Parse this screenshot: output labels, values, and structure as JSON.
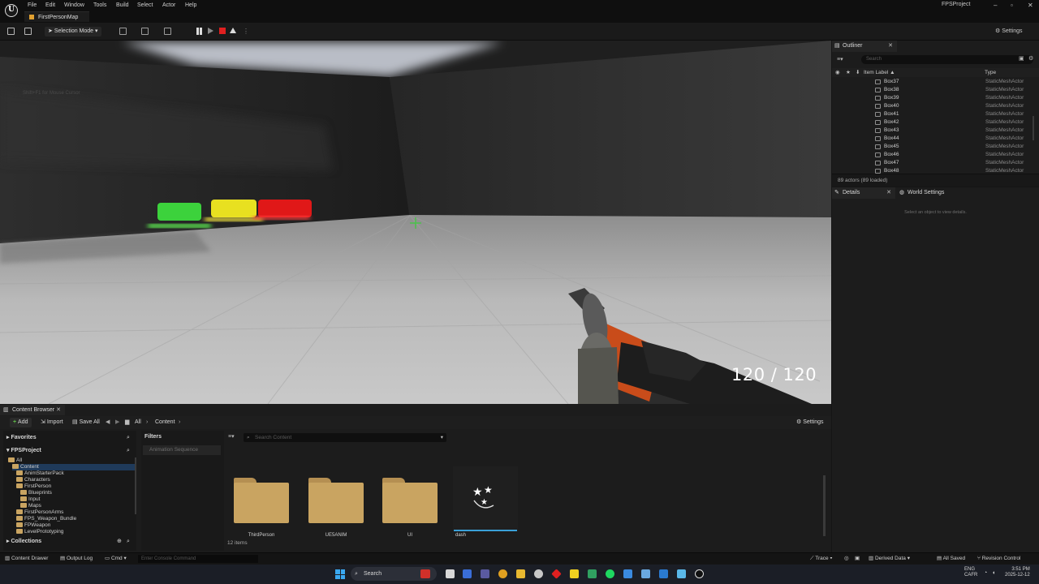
{
  "menubar": {
    "items": [
      "File",
      "Edit",
      "Window",
      "Tools",
      "Build",
      "Select",
      "Actor",
      "Help"
    ],
    "map_tab": "FirstPersonMap",
    "project": "FPSProject"
  },
  "toolbar": {
    "selection_mode": "Selection Mode",
    "settings": "Settings"
  },
  "viewport": {
    "hint": "Shift+F1 for Mouse Cursor",
    "ammo": "120 / 120",
    "health_fraction": 1.0,
    "colors": {
      "health": "#e0102a",
      "target_green": "#3cd23c",
      "target_yellow": "#e8e020",
      "target_red": "#e01818"
    }
  },
  "outliner": {
    "tab": "Outliner",
    "search_placeholder": "Search",
    "col_label": "Item Label ▲",
    "col_type": "Type",
    "rows": [
      {
        "label": "Box37",
        "type": "StaticMeshActor"
      },
      {
        "label": "Box38",
        "type": "StaticMeshActor"
      },
      {
        "label": "Box39",
        "type": "StaticMeshActor"
      },
      {
        "label": "Box40",
        "type": "StaticMeshActor"
      },
      {
        "label": "Box41",
        "type": "StaticMeshActor"
      },
      {
        "label": "Box42",
        "type": "StaticMeshActor"
      },
      {
        "label": "Box43",
        "type": "StaticMeshActor"
      },
      {
        "label": "Box44",
        "type": "StaticMeshActor"
      },
      {
        "label": "Box45",
        "type": "StaticMeshActor"
      },
      {
        "label": "Box46",
        "type": "StaticMeshActor"
      },
      {
        "label": "Box47",
        "type": "StaticMeshActor"
      },
      {
        "label": "Box48",
        "type": "StaticMeshActor"
      }
    ],
    "count": "89 actors (89 loaded)"
  },
  "details": {
    "tab": "Details",
    "world_tab": "World Settings",
    "empty_message": "Select an object to view details."
  },
  "content_browser": {
    "tab": "Content Browser",
    "add": "Add",
    "import": "Import",
    "save_all": "Save All",
    "crumb_all": "All",
    "crumb_content": "Content",
    "settings": "Settings",
    "favorites": "Favorites",
    "project": "FPSProject",
    "tree": [
      {
        "label": "All",
        "indent": 0
      },
      {
        "label": "Content",
        "indent": 1
      },
      {
        "label": "AnimStarterPack",
        "indent": 2
      },
      {
        "label": "Characters",
        "indent": 2
      },
      {
        "label": "FirstPerson",
        "indent": 2
      },
      {
        "label": "Blueprints",
        "indent": 3
      },
      {
        "label": "Input",
        "indent": 3
      },
      {
        "label": "Maps",
        "indent": 3
      },
      {
        "label": "FirstPersonArms",
        "indent": 2
      },
      {
        "label": "FPS_Weapon_Bundle",
        "indent": 2
      },
      {
        "label": "FPWeapon",
        "indent": 2
      },
      {
        "label": "LevelPrototyping",
        "indent": 2
      }
    ],
    "collections": "Collections",
    "filters_title": "Filters",
    "filter_chip": "Animation Sequence",
    "search_placeholder": "Search Content",
    "assets": [
      "ThirdPerson",
      "UE5ANIM",
      "UI",
      "dash"
    ],
    "item_count": "12 items"
  },
  "statusbar": {
    "content_drawer": "Content Drawer",
    "output_log": "Output Log",
    "cmd": "Cmd",
    "console_placeholder": "Enter Console Command",
    "trace": "Trace",
    "derived_data": "Derived Data",
    "all_saved": "All Saved",
    "revision_control": "Revision Control"
  },
  "taskbar": {
    "search": "Search",
    "lang1": "ENG",
    "lang2": "CAFR",
    "time": "3:51 PM",
    "date": "2025-12-12"
  }
}
